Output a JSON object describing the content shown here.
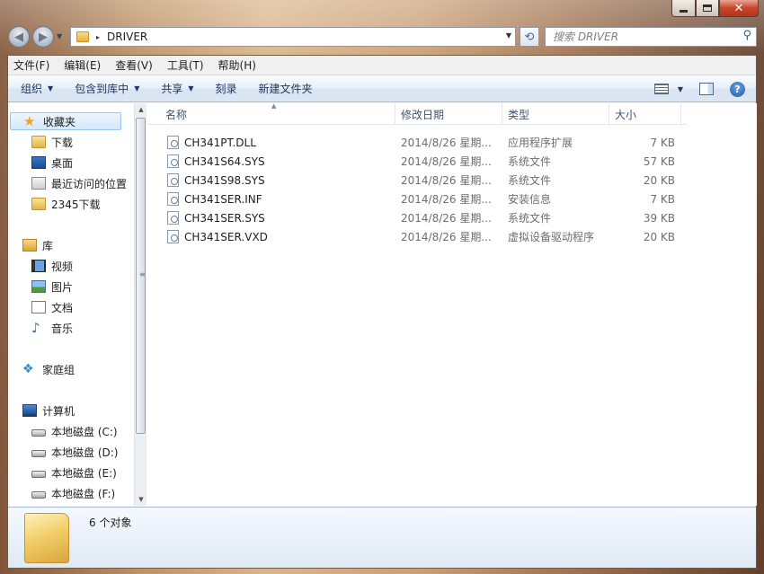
{
  "window": {
    "minimize_glyph": "—",
    "maximize_glyph": "□",
    "close_glyph": "✕"
  },
  "address_bar": {
    "back_glyph": "◀",
    "forward_glyph": "▶",
    "breadcrumb_separator": "▸",
    "path": "DRIVER",
    "refresh_glyph": "⟲",
    "search_placeholder": "搜索 DRIVER",
    "search_glyph": "⚲"
  },
  "menu": {
    "items": [
      "文件(F)",
      "编辑(E)",
      "查看(V)",
      "工具(T)",
      "帮助(H)"
    ]
  },
  "toolbar": {
    "organize": "组织",
    "include_in_library": "包含到库中",
    "share": "共享",
    "burn": "刻录",
    "new_folder": "新建文件夹",
    "help_glyph": "?"
  },
  "nav": {
    "favorites": "收藏夹",
    "downloads": "下载",
    "desktop": "桌面",
    "recent": "最近访问的位置",
    "downloads2345": "2345下载",
    "libraries": "库",
    "videos": "视频",
    "pictures": "图片",
    "documents": "文档",
    "music": "音乐",
    "homegroup": "家庭组",
    "computer": "计算机",
    "drive_c": "本地磁盘 (C:)",
    "drive_d": "本地磁盘 (D:)",
    "drive_e": "本地磁盘 (E:)",
    "drive_f": "本地磁盘 (F:)"
  },
  "columns": {
    "name": "名称",
    "modified": "修改日期",
    "type": "类型",
    "size": "大小"
  },
  "files": [
    {
      "name": "CH341PT.DLL",
      "modified": "2014/8/26 星期...",
      "type": "应用程序扩展",
      "size": "7 KB"
    },
    {
      "name": "CH341S64.SYS",
      "modified": "2014/8/26 星期...",
      "type": "系统文件",
      "size": "57 KB"
    },
    {
      "name": "CH341S98.SYS",
      "modified": "2014/8/26 星期...",
      "type": "系统文件",
      "size": "20 KB"
    },
    {
      "name": "CH341SER.INF",
      "modified": "2014/8/26 星期...",
      "type": "安装信息",
      "size": "7 KB"
    },
    {
      "name": "CH341SER.SYS",
      "modified": "2014/8/26 星期...",
      "type": "系统文件",
      "size": "39 KB"
    },
    {
      "name": "CH341SER.VXD",
      "modified": "2014/8/26 星期...",
      "type": "虚拟设备驱动程序",
      "size": "20 KB"
    }
  ],
  "details": {
    "count": "6 个对象"
  }
}
